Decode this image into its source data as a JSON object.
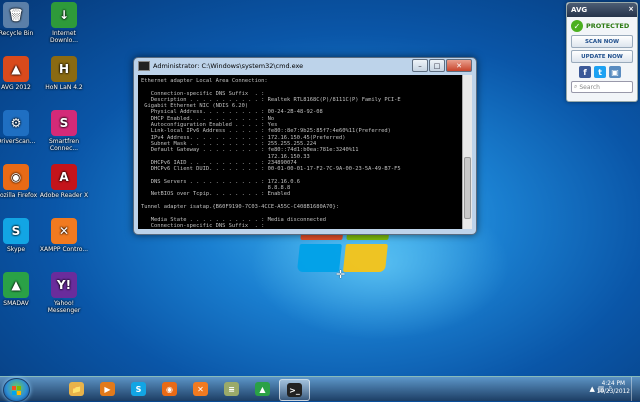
{
  "desktop": {
    "icons": [
      {
        "label": "Recycle Bin",
        "icon": "recycle-bin-icon",
        "color": "#5b7fa8",
        "glyph": "🗑"
      },
      {
        "label": "Internet Downlo...",
        "icon": "download-manager-icon",
        "color": "#2e9a3a",
        "glyph": "↓"
      },
      {
        "label": "AVG 2012",
        "icon": "avg-icon",
        "color": "#d94a1c",
        "glyph": "▲"
      },
      {
        "label": "HoN LaN 4.2",
        "icon": "hon-icon",
        "color": "#8a6a12",
        "glyph": "H"
      },
      {
        "label": "DriverScan...",
        "icon": "driverscanner-icon",
        "color": "#1f6fc2",
        "glyph": "⚙"
      },
      {
        "label": "Smartfren Connec...",
        "icon": "smartfren-icon",
        "color": "#d42a78",
        "glyph": "S"
      },
      {
        "label": "Mozilla Firefox",
        "icon": "firefox-icon",
        "color": "#e86a16",
        "glyph": "◉"
      },
      {
        "label": "Adobe Reader X",
        "icon": "adobe-reader-icon",
        "color": "#c4141b",
        "glyph": "A"
      },
      {
        "label": "Skype",
        "icon": "skype-icon",
        "color": "#12a5e4",
        "glyph": "S"
      },
      {
        "label": "XAMPP Contro...",
        "icon": "xampp-icon",
        "color": "#f17a20",
        "glyph": "✕"
      },
      {
        "label": "SMADAV",
        "icon": "smadav-icon",
        "color": "#2aa146",
        "glyph": "▲"
      },
      {
        "label": "Yahoo! Messenger",
        "icon": "yahoo-messenger-icon",
        "color": "#6a2c9c",
        "glyph": "Y!"
      }
    ]
  },
  "cmd_window": {
    "title": "Administrator: C:\\Windows\\system32\\cmd.exe",
    "lines": [
      "Ethernet adapter Local Area Connection:",
      "",
      "   Connection-specific DNS Suffix  . :",
      "   Description . . . . . . . . . . . : Realtek RTL8168C(P)/8111C(P) Family PCI-E",
      " Gigabit Ethernet NIC (NDIS 6.20)",
      "   Physical Address. . . . . . . . . : 00-24-2B-48-92-08",
      "   DHCP Enabled. . . . . . . . . . . : No",
      "   Autoconfiguration Enabled . . . . : Yes",
      "   Link-local IPv6 Address . . . . . : fe80::8e7:9b25:85f7:4e60%11(Preferred)",
      "   IPv4 Address. . . . . . . . . . . : 172.16.150.45(Preferred)",
      "   Subnet Mask . . . . . . . . . . . : 255.255.255.224",
      "   Default Gateway . . . . . . . . . : fe80::74d1:b0ea:781e:3240%11",
      "                                       172.16.150.33",
      "   DHCPv6 IAID . . . . . . . . . . . : 234890074",
      "   DHCPv6 Client DUID. . . . . . . . : 00-01-00-01-17-F2-7C-9A-00-23-5A-49-B7-F5",
      "",
      "   DNS Servers . . . . . . . . . . . : 172.16.0.6",
      "                                       8.8.8.8",
      "   NetBIOS over Tcpip. . . . . . . . : Enabled",
      "",
      "Tunnel adapter isatap.{B60F9190-7C03-4CCE-A55C-C408B1680A70}:",
      "",
      "   Media State . . . . . . . . . . . : Media disconnected",
      "   Connection-specific DNS Suffix  . :"
    ]
  },
  "avg_gadget": {
    "brand": "AVG",
    "status": "PROTECTED",
    "scan_button": "SCAN NOW",
    "update_button": "UPDATE NOW",
    "search_placeholder": "Search",
    "colors": {
      "facebook": "#3b5998",
      "twitter": "#1da1f2",
      "other": "#5a8cc0"
    }
  },
  "taskbar": {
    "items": [
      {
        "icon": "windows-explorer-icon",
        "color": "#e8b34a",
        "glyph": "📁",
        "active": false
      },
      {
        "icon": "media-player-icon",
        "color": "#e27a1b",
        "glyph": "▶",
        "active": false
      },
      {
        "icon": "skype-icon",
        "color": "#12a5e4",
        "glyph": "S",
        "active": false
      },
      {
        "icon": "firefox-icon",
        "color": "#e86a16",
        "glyph": "◉",
        "active": false
      },
      {
        "icon": "xampp-icon",
        "color": "#f17a20",
        "glyph": "✕",
        "active": false
      },
      {
        "icon": "notepad-icon",
        "color": "#9aaa6a",
        "glyph": "≡",
        "active": false
      },
      {
        "icon": "smadav-icon",
        "color": "#2aa146",
        "glyph": "▲",
        "active": false
      },
      {
        "icon": "cmd-icon",
        "color": "#222222",
        "glyph": ">_",
        "active": true
      }
    ],
    "time": "4:24 PM",
    "date": "10/23/2012"
  }
}
